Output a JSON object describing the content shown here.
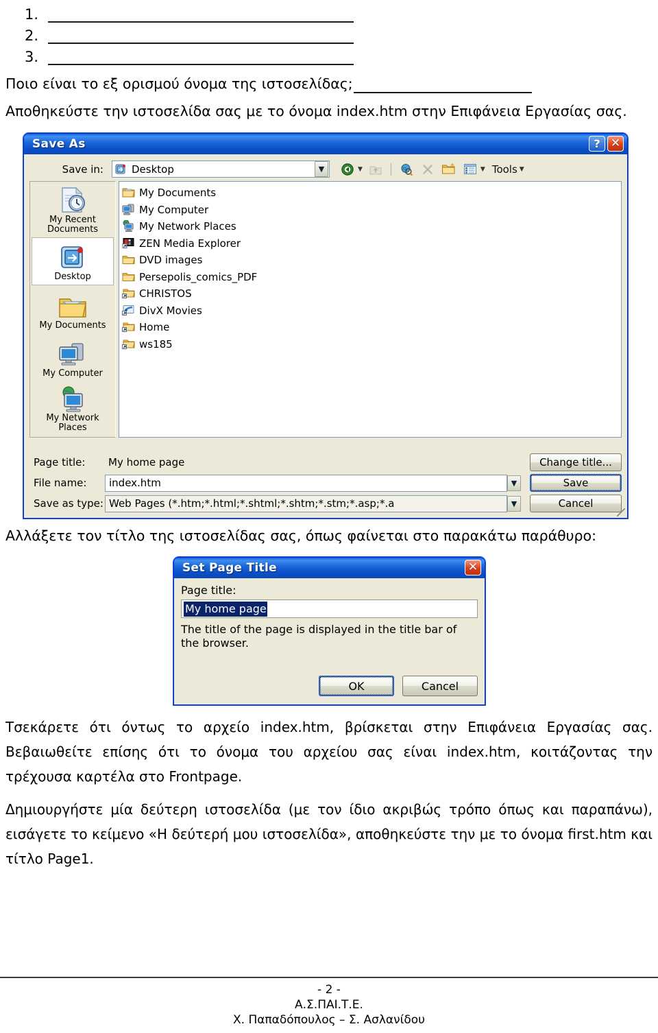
{
  "worksheet": {
    "numbered_blanks": [
      "1.",
      "2.",
      "3."
    ],
    "question_line": "Ποιο είναι το εξ ορισμού όνομα της ιστοσελίδας;",
    "save_instruction": "Αποθηκεύστε την ιστοσελίδα σας με το όνομα index.htm στην Επιφάνεια Εργασίας σας.",
    "change_title_instruction": "Αλλάξετε τον τίτλο της ιστοσελίδας σας, όπως φαίνεται στο παρακάτω παράθυρο:",
    "paragraph_1": "Τσεκάρετε ότι όντως το αρχείο index.htm, βρίσκεται στην Επιφάνεια Εργασίας σας. Βεβαιωθείτε επίσης ότι το όνομα του αρχείου σας είναι index.htm, κοιτάζοντας την τρέχουσα καρτέλα στο Frontpage.",
    "paragraph_2": "Δημιουργήστε μία δεύτερη ιστοσελίδα (με τον ίδιο ακριβώς τρόπο όπως και παραπάνω), εισάγετε το κείμενο «Η δεύτερή μου ιστοσελίδα», αποθηκεύστε την με το όνομα first.htm και τίτλο Page1."
  },
  "save_as_dialog": {
    "title": "Save As",
    "help_glyph": "?",
    "close_glyph": "✕",
    "save_in_label": "Save in:",
    "save_in_value": "Desktop",
    "toolbar": {
      "back_label": "Back",
      "up_label": "Up One Level",
      "search_web_label": "Search the Web",
      "delete_label": "Delete",
      "new_folder_label": "Create New Folder",
      "views_label": "Views",
      "tools_label": "Tools"
    },
    "places": [
      {
        "label": "My Recent Documents",
        "icon": "recent-documents-icon",
        "selected": false
      },
      {
        "label": "Desktop",
        "icon": "desktop-icon",
        "selected": true
      },
      {
        "label": "My Documents",
        "icon": "my-documents-icon",
        "selected": false
      },
      {
        "label": "My Computer",
        "icon": "my-computer-icon",
        "selected": false
      },
      {
        "label": "My Network Places",
        "icon": "network-places-icon",
        "selected": false
      }
    ],
    "files": [
      {
        "name": "My Documents",
        "icon": "my-documents-icon"
      },
      {
        "name": "My Computer",
        "icon": "my-computer-icon"
      },
      {
        "name": "My Network Places",
        "icon": "network-places-icon"
      },
      {
        "name": "ZEN Media Explorer",
        "icon": "shortcut-app-icon"
      },
      {
        "name": "DVD images",
        "icon": "folder-icon"
      },
      {
        "name": "Persepolis_comics_PDF",
        "icon": "folder-icon"
      },
      {
        "name": "CHRISTOS",
        "icon": "folder-shortcut-icon"
      },
      {
        "name": "DivX Movies",
        "icon": "shortcut-app-icon"
      },
      {
        "name": "Home",
        "icon": "folder-shortcut-icon"
      },
      {
        "name": "ws185",
        "icon": "folder-shortcut-icon"
      }
    ],
    "page_title_label": "Page title:",
    "page_title_value": "My home page",
    "change_title_button": "Change title...",
    "file_name_label": "File name:",
    "file_name_value": "index.htm",
    "save_as_type_label": "Save as type:",
    "save_as_type_value": "Web Pages (*.htm;*.html;*.shtml;*.shtm;*.stm;*.asp;*.a",
    "save_button": "Save",
    "cancel_button": "Cancel"
  },
  "set_page_title_dialog": {
    "title": "Set Page Title",
    "close_glyph": "✕",
    "page_title_label": "Page title:",
    "page_title_value": "My home page",
    "description": "The title of the page is displayed in the title bar of the browser.",
    "ok_button": "OK",
    "cancel_button": "Cancel"
  },
  "footer": {
    "page_number": "- 2 -",
    "institution": "Α.Σ.ΠΑΙ.Τ.Ε.",
    "authors": "Χ. Παπαδόπουλος – Σ. Ασλανίδου"
  },
  "colors": {
    "title_bar_blue": "#1c67da",
    "dialog_face": "#ece9d8",
    "selection_blue": "#0a246a",
    "close_red": "#d9421c"
  }
}
